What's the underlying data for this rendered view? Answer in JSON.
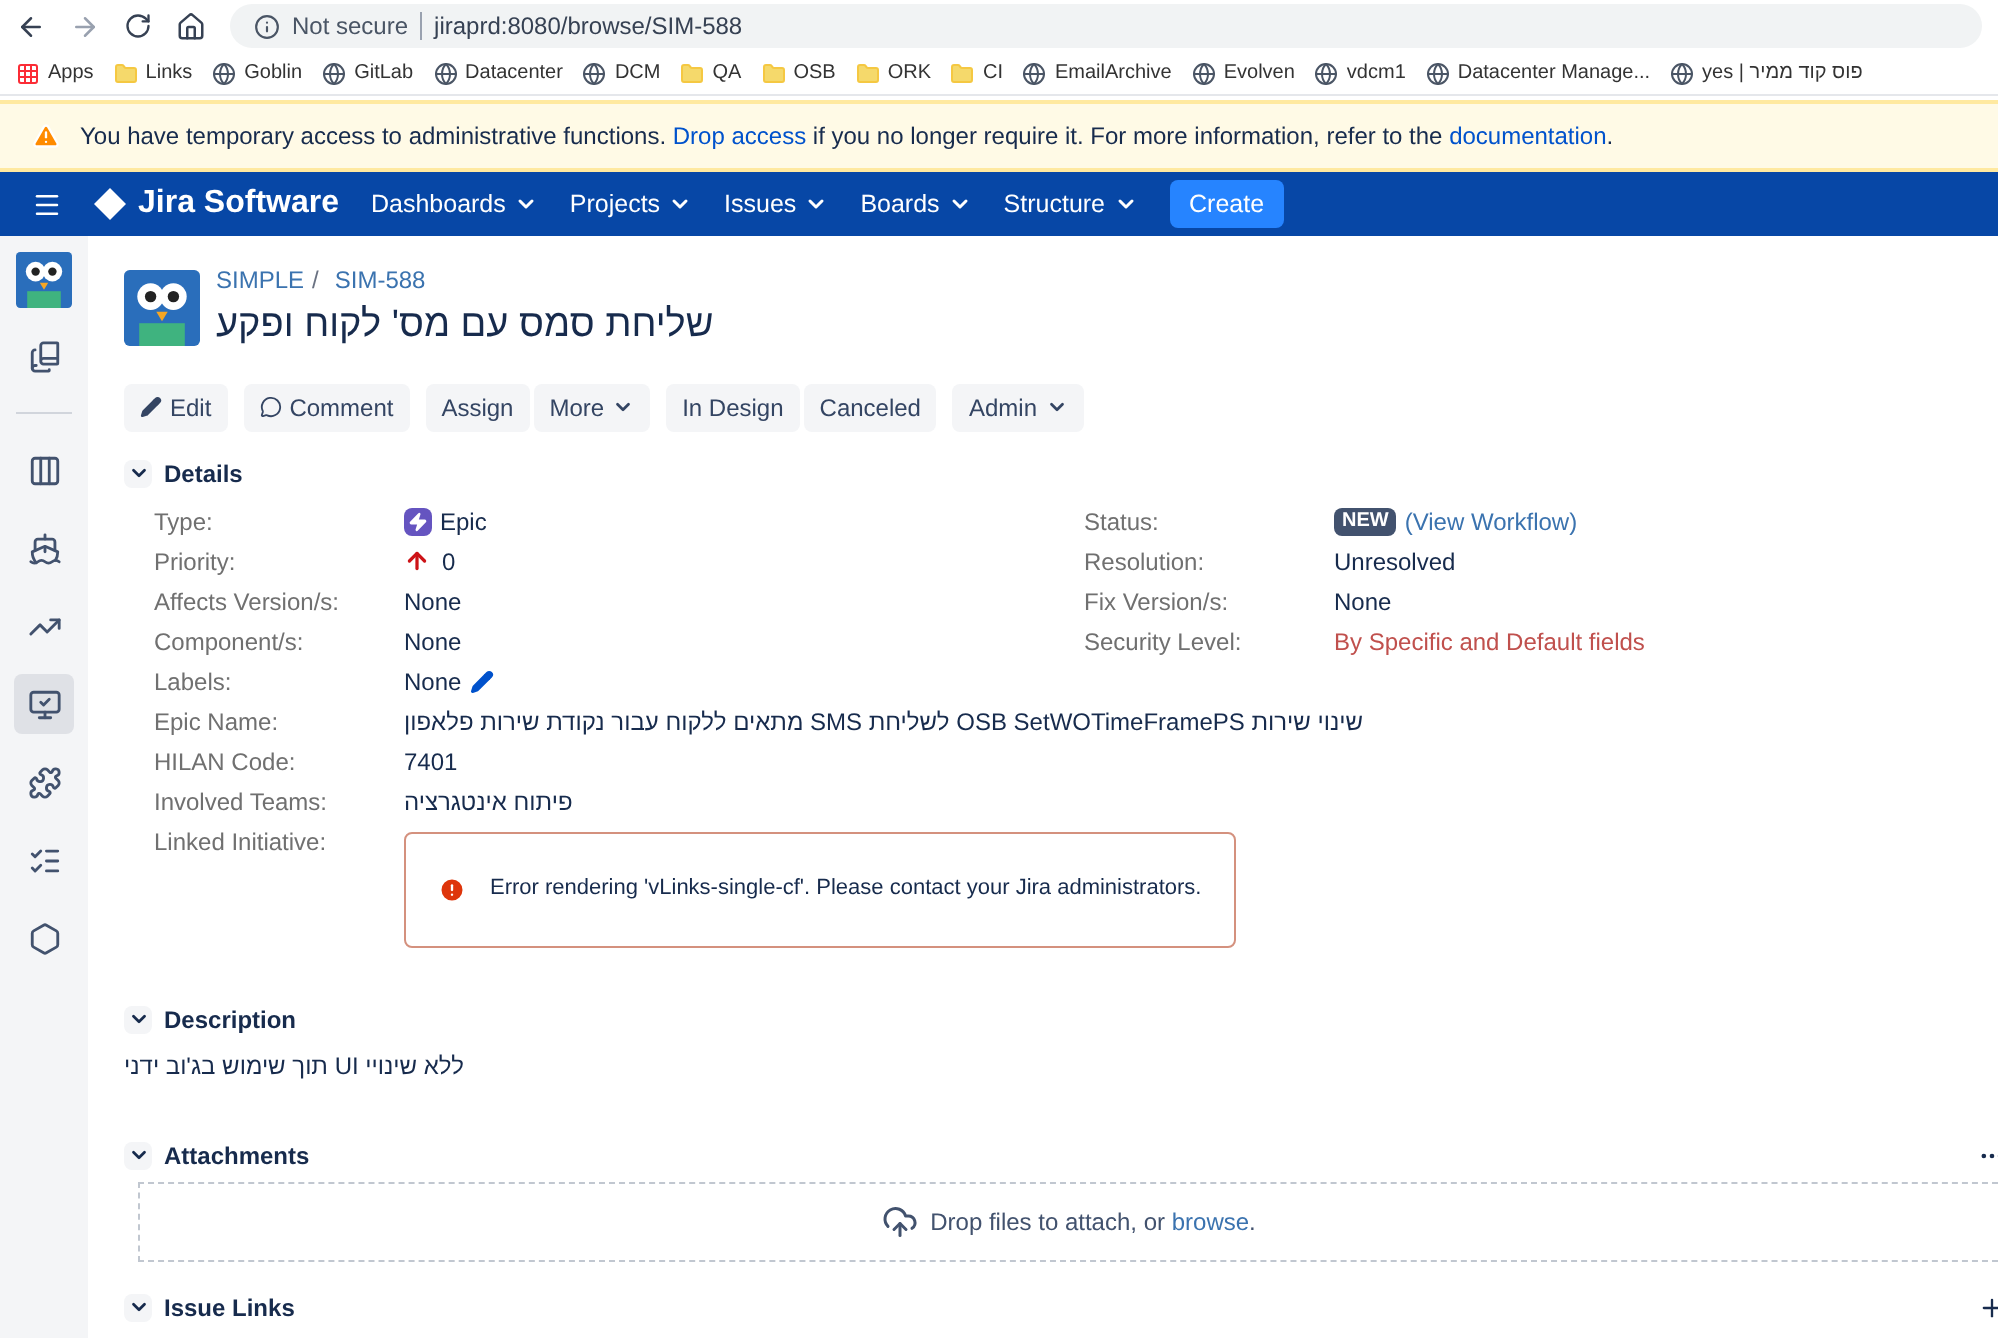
{
  "browser": {
    "security": "Not secure",
    "url": "jiraprd:8080/browse/SIM-588",
    "bookmarks": [
      {
        "label": "Apps",
        "kind": "apps"
      },
      {
        "label": "Links",
        "kind": "folder"
      },
      {
        "label": "Goblin",
        "kind": "site"
      },
      {
        "label": "GitLab",
        "kind": "site"
      },
      {
        "label": "Datacenter",
        "kind": "site"
      },
      {
        "label": "DCM",
        "kind": "site"
      },
      {
        "label": "QA",
        "kind": "folder"
      },
      {
        "label": "OSB",
        "kind": "folder"
      },
      {
        "label": "ORK",
        "kind": "folder"
      },
      {
        "label": "CI",
        "kind": "folder"
      },
      {
        "label": "EmailArchive",
        "kind": "site"
      },
      {
        "label": "Evolven",
        "kind": "site"
      },
      {
        "label": "vdcm1",
        "kind": "site"
      },
      {
        "label": "Datacenter Manage...",
        "kind": "site"
      },
      {
        "label": "yes | פוס קוד ממיר",
        "kind": "site"
      }
    ]
  },
  "banner": {
    "text_start": "You have temporary access to administrative functions. ",
    "drop_link": "Drop access",
    "text_middle": " if you no longer require it. For more information, refer to the ",
    "doc_link": "documentation",
    "text_end": "."
  },
  "nav": {
    "product": "Jira Software",
    "menus": [
      "Dashboards",
      "Projects",
      "Issues",
      "Boards",
      "Structure"
    ],
    "create": "Create"
  },
  "sidebar": {
    "items": [
      {
        "kind": "backlog",
        "selected": false
      },
      {
        "kind": "board",
        "selected": false
      },
      {
        "kind": "releases",
        "selected": false
      },
      {
        "kind": "reports",
        "selected": false
      },
      {
        "kind": "issues",
        "selected": true
      },
      {
        "kind": "components",
        "selected": false
      },
      {
        "kind": "list",
        "selected": false
      },
      {
        "kind": "settings",
        "selected": false
      }
    ]
  },
  "issue": {
    "project": "SIMPLE",
    "separator": "/",
    "key": "SIM-588",
    "title": "שליחת סמס עם מס' לקוח ופקע"
  },
  "toolbar": [
    [
      {
        "label": "Edit",
        "kind": "edit"
      }
    ],
    [
      {
        "label": "Comment",
        "kind": "comment"
      }
    ],
    [
      {
        "label": "Assign",
        "kind": "plain"
      },
      {
        "label": "More",
        "kind": "dropdown"
      }
    ],
    [
      {
        "label": "In Design",
        "kind": "plain"
      },
      {
        "label": "Canceled",
        "kind": "plain"
      }
    ],
    [
      {
        "label": "Admin",
        "kind": "dropdown"
      }
    ]
  ],
  "details": {
    "title": "Details",
    "expanded": true,
    "left": [
      {
        "label": "Type:",
        "value": "Epic",
        "kind": "type"
      },
      {
        "label": "Priority:",
        "value": "0",
        "kind": "priority"
      },
      {
        "label": "Affects Version/s:",
        "value": "None",
        "kind": "text"
      },
      {
        "label": "Component/s:",
        "value": "None",
        "kind": "text"
      },
      {
        "label": "Labels:",
        "value": "None",
        "kind": "labels"
      },
      {
        "label": "Epic Name:",
        "value": "מתאים ללקוח עבור נקודת שירות פלאפון SMS לשליחת OSB SetWOTimeFramePS שינוי שירות",
        "kind": "text"
      },
      {
        "label": "HILAN Code:",
        "value": "7401",
        "kind": "text"
      },
      {
        "label": "Involved Teams:",
        "value": "פיתוח אינטגרציה",
        "kind": "text"
      },
      {
        "label": "Linked Initiative:",
        "value": "Error rendering 'vLinks-single-cf'. Please contact your Jira administrators.",
        "kind": "error"
      }
    ],
    "right": [
      {
        "label": "Status:",
        "value": "NEW",
        "link": "(View Workflow)",
        "kind": "status"
      },
      {
        "label": "Resolution:",
        "value": "Unresolved",
        "kind": "text"
      },
      {
        "label": "Fix Version/s:",
        "value": "None",
        "kind": "text"
      },
      {
        "label": "Security Level:",
        "value": "By Specific and Default fields",
        "kind": "security"
      }
    ]
  },
  "description": {
    "title": "Description",
    "expanded": true,
    "text": "תוך שימוש בג'וב ידני UI ללא שינויי"
  },
  "attachments": {
    "title": "Attachments",
    "expanded": true,
    "drop_text": "Drop files to attach, or ",
    "browse": "browse",
    "end": "."
  },
  "issue_links": {
    "title": "Issue Links",
    "expanded": true
  }
}
